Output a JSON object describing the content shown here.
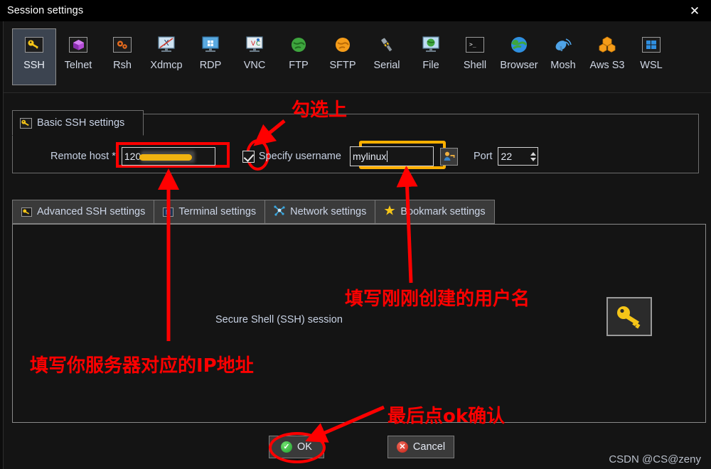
{
  "window": {
    "title": "Session settings",
    "close_icon": "close-icon"
  },
  "protocols": [
    {
      "label": "SSH",
      "icon": "key-icon",
      "selected": true
    },
    {
      "label": "Telnet",
      "icon": "cube-icon",
      "selected": false
    },
    {
      "label": "Rsh",
      "icon": "gears-icon",
      "selected": false
    },
    {
      "label": "Xdmcp",
      "icon": "xdmcp-icon",
      "selected": false
    },
    {
      "label": "RDP",
      "icon": "windows-monitor-icon",
      "selected": false
    },
    {
      "label": "VNC",
      "icon": "vnc-monitor-icon",
      "selected": false
    },
    {
      "label": "FTP",
      "icon": "green-globe-icon",
      "selected": false
    },
    {
      "label": "SFTP",
      "icon": "orange-globe-icon",
      "selected": false
    },
    {
      "label": "Serial",
      "icon": "serial-plug-icon",
      "selected": false
    },
    {
      "label": "File",
      "icon": "file-monitor-icon",
      "selected": false
    },
    {
      "label": "Shell",
      "icon": "terminal-icon",
      "selected": false
    },
    {
      "label": "Browser",
      "icon": "globe-icon",
      "selected": false
    },
    {
      "label": "Mosh",
      "icon": "satellite-dish-icon",
      "selected": false
    },
    {
      "label": "Aws S3",
      "icon": "aws-cubes-icon",
      "selected": false
    },
    {
      "label": "WSL",
      "icon": "windows-icon",
      "selected": false
    }
  ],
  "basic_ssh": {
    "group_label": "Basic SSH settings",
    "group_icon": "key-icon",
    "remote_host_label": "Remote host *",
    "remote_host_value": "120",
    "remote_host_redacted": true,
    "specify_username_label": "Specify username",
    "specify_username_checked": true,
    "username_value": "mylinux",
    "user_button_icon": "user-key-icon",
    "port_label": "Port",
    "port_value": "22"
  },
  "tabs": [
    {
      "label": "Advanced SSH settings",
      "icon": "key-icon",
      "active": false
    },
    {
      "label": "Terminal settings",
      "icon": "terminal-small-icon",
      "active": false
    },
    {
      "label": "Network settings",
      "icon": "network-icon",
      "active": false
    },
    {
      "label": "Bookmark settings",
      "icon": "star-icon",
      "active": false
    }
  ],
  "panel": {
    "session_description": "Secure Shell (SSH) session",
    "session_icon": "key-icon"
  },
  "buttons": {
    "ok_label": "OK",
    "ok_icon": "green-check-icon",
    "cancel_label": "Cancel",
    "cancel_icon": "red-x-icon"
  },
  "watermark": "CSDN @CS@zeny",
  "annotations": [
    {
      "id": "check-it",
      "text": "勾选上"
    },
    {
      "id": "username",
      "text": "填写刚刚创建的用户名"
    },
    {
      "id": "ip-address",
      "text": "填写你服务器对应的IP地址"
    },
    {
      "id": "click-ok",
      "text": "最后点ok确认"
    }
  ],
  "colors": {
    "annotation_red": "#ff0000",
    "highlight_orange": "#ffb000",
    "window_bg": "#141414",
    "titlebar_bg": "#000000",
    "selected_tile": "#3c4450",
    "label_text": "#c8d2e4"
  }
}
